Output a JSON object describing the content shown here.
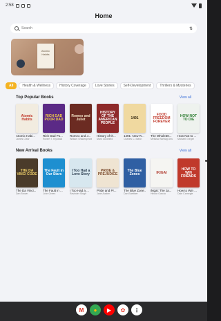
{
  "status": {
    "time": "2:58",
    "signal": "▾"
  },
  "title": "Home",
  "search": {
    "placeholder": "Search",
    "filter_icon": "filter-icon"
  },
  "banner": {
    "book_title": "Atomic Habits"
  },
  "categories": [
    "All",
    "Health & Wellness",
    "History Coverage",
    "Love Stories",
    "Self-Development",
    "Thrillers & Mysteries"
  ],
  "popular": {
    "title": "Top Popular Books",
    "view_all": "View all",
    "books": [
      {
        "cover_text": "Atomic Habits",
        "title": "Atomic Habi...",
        "author": "James Clear",
        "bg": "#f2ece0",
        "fg": "#c0392b"
      },
      {
        "cover_text": "RICH DAD POOR DAD",
        "title": "Rich Dad Po...",
        "author": "Robert T. Kiyosaki",
        "bg": "#5b2a86",
        "fg": "#f5d142"
      },
      {
        "cover_text": "Romeo and Juliet",
        "title": "Romeo and J...",
        "author": "William Shakespeare",
        "bg": "#6b2b22",
        "fg": "#f1e1c4"
      },
      {
        "cover_text": "HISTORY OF THE AMERICAN PEOPLE",
        "title": "History of th...",
        "author": "Mark Glowfield",
        "bg": "#8e2a2a",
        "fg": "#fff"
      },
      {
        "cover_text": "1491",
        "title": "1491: New R...",
        "author": "Charles C. Mann",
        "bg": "#f0d9a0",
        "fg": "#3a2d15"
      },
      {
        "cover_text": "FOOD FREEDOM FOREVER",
        "title": "The Whole30...",
        "author": "Melissa Hartwig Urban",
        "bg": "#ffffff",
        "fg": "#c0392b"
      },
      {
        "cover_text": "HOW NOT TO DIE",
        "title": "How Not to ...",
        "author": "Michael Greger",
        "bg": "#eef2ee",
        "fg": "#2e7d32"
      }
    ]
  },
  "arrivals": {
    "title": "New Arrival Books",
    "view_all": "View all",
    "books": [
      {
        "cover_text": "THE DA VINCI CODE",
        "title": "The Da Vinci...",
        "author": "Dan Brown",
        "bg": "#4a3b2a",
        "fg": "#f2d36b"
      },
      {
        "cover_text": "The Fault in Our Stars",
        "title": "The Fault in ...",
        "author": "John Green",
        "bg": "#1e8fd0",
        "fg": "#fff"
      },
      {
        "cover_text": "I Too Had a Love Story",
        "title": "I Too Had a ...",
        "author": "Ravinder Singh",
        "bg": "#d7e7ef",
        "fg": "#2c3e50"
      },
      {
        "cover_text": "PRIDE & PREJUDICE",
        "title": "Pride and Pr...",
        "author": "Jane Austen",
        "bg": "#efe4d2",
        "fg": "#7a4a2c"
      },
      {
        "cover_text": "The Blue Zones",
        "title": "The Blue Zone...",
        "author": "Dan Buettner",
        "bg": "#2f5fa3",
        "fg": "#fff"
      },
      {
        "cover_text": "IKIGAI",
        "title": "Ikigai: The Ja...",
        "author": "Héctor García",
        "bg": "#f5f5f2",
        "fg": "#b03a2e"
      },
      {
        "cover_text": "HOW TO WIN FRIENDS",
        "title": "How to Win ...",
        "author": "Dale Carnegie",
        "bg": "#c0392b",
        "fg": "#fff"
      }
    ]
  },
  "dock": [
    {
      "name": "gmail",
      "glyph": "M",
      "bg": "#ffffff",
      "fg": "#d93025"
    },
    {
      "name": "chrome",
      "glyph": "●",
      "bg": "#34a853",
      "fg": "#fbbc05"
    },
    {
      "name": "youtube",
      "glyph": "▶",
      "bg": "#ff0000",
      "fg": "#ffffff"
    },
    {
      "name": "photos",
      "glyph": "✿",
      "bg": "#ffffff",
      "fg": "#ea4335"
    },
    {
      "name": "apps",
      "glyph": "⋮",
      "bg": "#ffffff",
      "fg": "#333333"
    }
  ]
}
